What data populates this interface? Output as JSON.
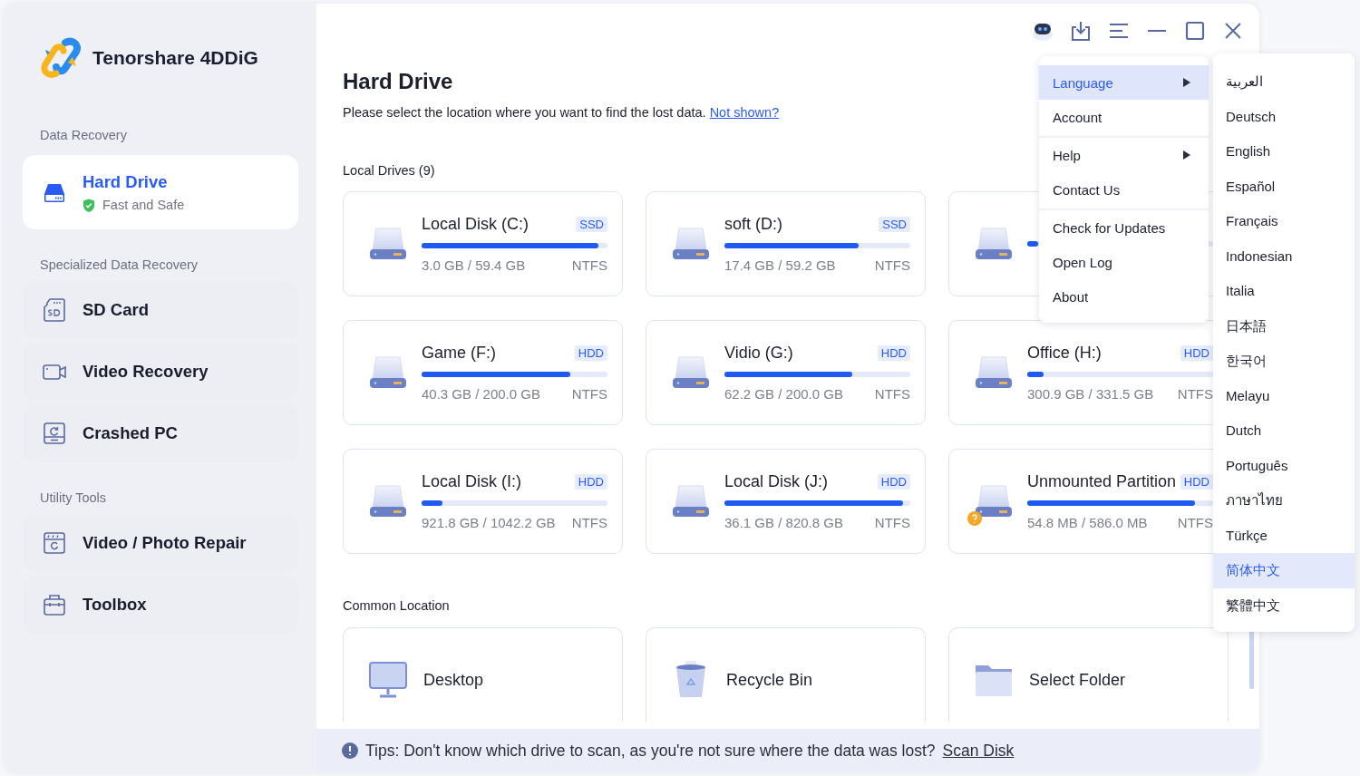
{
  "app": {
    "title": "Tenorshare 4DDiG"
  },
  "sidebar": {
    "sections": [
      {
        "heading": "Data Recovery",
        "items": [
          {
            "label": "Hard Drive",
            "subtitle": "Fast and Safe",
            "kind": "drive",
            "selected": true
          }
        ]
      },
      {
        "heading": "Specialized Data Recovery",
        "items": [
          {
            "label": "SD Card",
            "kind": "sd",
            "selected": false
          },
          {
            "label": "Video Recovery",
            "kind": "video",
            "selected": false
          },
          {
            "label": "Crashed PC",
            "kind": "crashed",
            "selected": false
          }
        ]
      },
      {
        "heading": "Utility Tools",
        "items": [
          {
            "label": "Video / Photo Repair",
            "kind": "repair",
            "selected": false
          },
          {
            "label": "Toolbox",
            "kind": "toolbox",
            "selected": false
          }
        ]
      }
    ]
  },
  "page": {
    "title": "Hard Drive",
    "description": "Please select the location where you want to find the lost data.",
    "link": "Not shown?"
  },
  "local_drives": {
    "heading": "Local Drives (9)",
    "drives": [
      {
        "name": "Local Disk (C:)",
        "type": "SSD",
        "level": 0.95,
        "size": "3.0 GB / 59.4 GB",
        "filesystem": "NTFS",
        "warning": false
      },
      {
        "name": "soft (D:)",
        "type": "SSD",
        "level": 0.72,
        "size": "17.4 GB / 59.2 GB",
        "filesystem": "NTFS",
        "warning": false
      },
      {
        "level": 0.06,
        "warning": false
      },
      {
        "name": "Game (F:)",
        "type": "HDD",
        "level": 0.8,
        "size": "40.3 GB / 200.0 GB",
        "filesystem": "NTFS",
        "warning": false
      },
      {
        "name": "Vidio (G:)",
        "type": "HDD",
        "level": 0.69,
        "size": "62.2 GB / 200.0 GB",
        "filesystem": "NTFS",
        "warning": false
      },
      {
        "name": "Office (H:)",
        "type": "HDD",
        "level": 0.09,
        "size": "300.9 GB / 331.5 GB",
        "filesystem": "NTFS",
        "warning": false
      },
      {
        "name": "Local Disk (I:)",
        "type": "HDD",
        "level": 0.11,
        "size": "921.8 GB / 1042.2 GB",
        "filesystem": "NTFS",
        "warning": false
      },
      {
        "name": "Local Disk (J:)",
        "type": "HDD",
        "level": 0.96,
        "size": "36.1 GB / 820.8 GB",
        "filesystem": "NTFS",
        "warning": false
      },
      {
        "name": "Unmounted Partition",
        "type": "HDD",
        "level": 0.9,
        "size": "54.8 MB / 586.0 MB",
        "filesystem": "NTFS",
        "warning": true
      }
    ]
  },
  "common_location": {
    "heading": "Common Location",
    "items": [
      {
        "label": "Desktop",
        "kind": "desktop"
      },
      {
        "label": "Recycle Bin",
        "kind": "recycle"
      },
      {
        "label": "Select Folder",
        "kind": "folder"
      }
    ]
  },
  "tips": {
    "text": "Tips: Don't know which drive to scan, as you're not sure where the data was lost?",
    "link": "Scan Disk"
  },
  "menu": {
    "groups": [
      [
        {
          "label": "Language",
          "submenu": true,
          "selected": true
        },
        {
          "label": "Account",
          "submenu": false,
          "selected": false
        }
      ],
      [
        {
          "label": "Help",
          "submenu": true,
          "selected": false
        },
        {
          "label": "Contact Us",
          "submenu": false,
          "selected": false
        }
      ],
      [
        {
          "label": "Check for Updates",
          "submenu": false,
          "selected": false
        },
        {
          "label": "Open Log",
          "submenu": false,
          "selected": false
        },
        {
          "label": "About",
          "submenu": false,
          "selected": false
        }
      ]
    ]
  },
  "language_menu": {
    "items": [
      {
        "label": "العربية",
        "selected": false
      },
      {
        "label": "Deutsch",
        "selected": false
      },
      {
        "label": "English",
        "selected": false
      },
      {
        "label": "Español",
        "selected": false
      },
      {
        "label": "Français",
        "selected": false
      },
      {
        "label": "Indonesian",
        "selected": false
      },
      {
        "label": "Italia",
        "selected": false
      },
      {
        "label": "日本語",
        "selected": false
      },
      {
        "label": "한국어",
        "selected": false
      },
      {
        "label": "Melayu",
        "selected": false
      },
      {
        "label": "Dutch",
        "selected": false
      },
      {
        "label": "Português",
        "selected": false
      },
      {
        "label": "ภาษาไทย",
        "selected": false
      },
      {
        "label": "Türkçe",
        "selected": false
      },
      {
        "label": "简体中文",
        "selected": true
      },
      {
        "label": "繁體中文",
        "selected": false
      }
    ]
  }
}
